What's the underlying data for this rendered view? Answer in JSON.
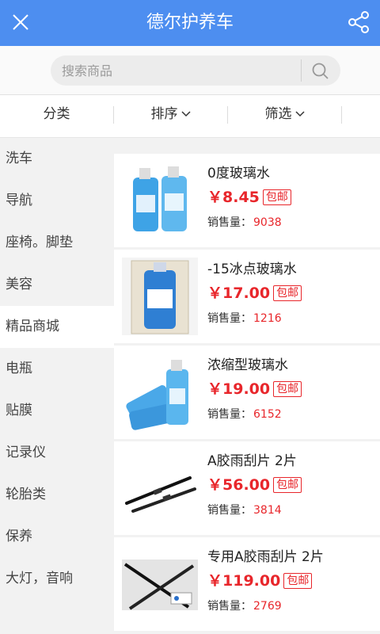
{
  "header": {
    "title": "德尔护养车"
  },
  "search": {
    "placeholder": "搜索商品"
  },
  "filters": [
    {
      "label": "分类"
    },
    {
      "label": "排序"
    },
    {
      "label": "筛选"
    }
  ],
  "sidebar": {
    "items": [
      {
        "label": "洗车"
      },
      {
        "label": "导航"
      },
      {
        "label": "座椅。脚垫"
      },
      {
        "label": "美容"
      },
      {
        "label": "精品商城"
      },
      {
        "label": "电瓶"
      },
      {
        "label": "贴膜"
      },
      {
        "label": "记录仪"
      },
      {
        "label": "轮胎类"
      },
      {
        "label": "保养"
      },
      {
        "label": "大灯，音响"
      }
    ],
    "active_index": 4
  },
  "products": [
    {
      "name": "0度玻璃水",
      "price": "￥8.45",
      "badge": "包邮",
      "sales_label": "销售量：",
      "sales": "9038",
      "image": "blue-bottles"
    },
    {
      "name": "-15冰点玻璃水",
      "price": "￥17.00",
      "badge": "包邮",
      "sales_label": "销售量：",
      "sales": "1216",
      "image": "blue-bottle-box"
    },
    {
      "name": "浓缩型玻璃水",
      "price": "￥19.00",
      "badge": "包邮",
      "sales_label": "销售量：",
      "sales": "6152",
      "image": "blue-bottles"
    },
    {
      "name": "A胶雨刮片 2片",
      "price": "￥56.00",
      "badge": "包邮",
      "sales_label": "销售量：",
      "sales": "3814",
      "image": "wiper-blades"
    },
    {
      "name": "专用A胶雨刮片 2片",
      "price": "￥119.00",
      "badge": "包邮",
      "sales_label": "销售量：",
      "sales": "2769",
      "image": "wiper-blades-box"
    }
  ],
  "colors": {
    "header": "#4d8ef0",
    "price": "#e8262b"
  }
}
